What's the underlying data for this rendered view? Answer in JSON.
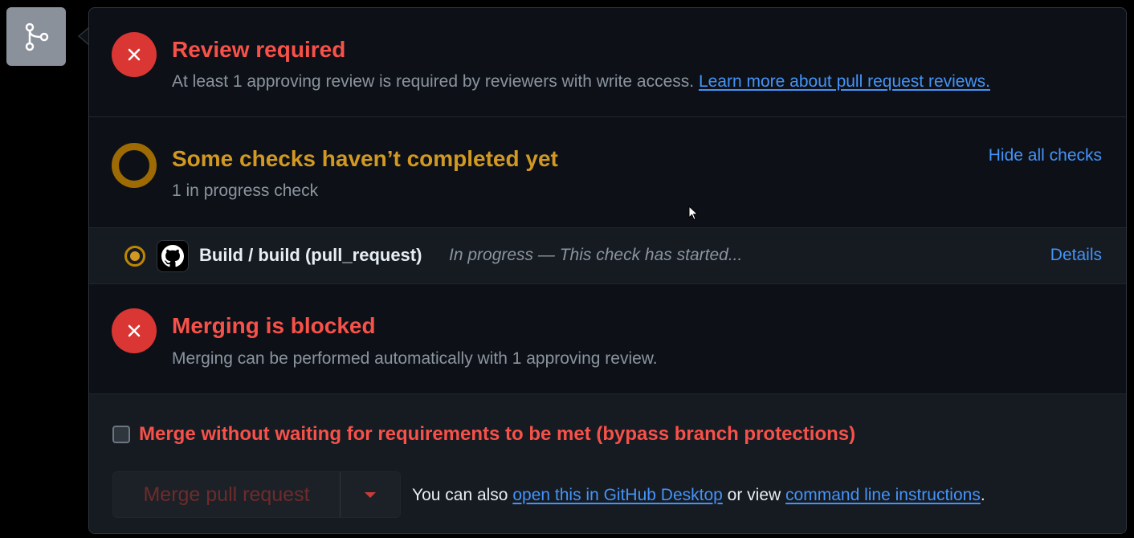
{
  "icons": {
    "merge": "git-merge-icon",
    "x": "x-icon",
    "pending": "pending-ring-icon",
    "in_progress": "in-progress-dot-icon",
    "github": "github-icon",
    "caret": "caret-down-icon",
    "cursor": "mouse-cursor-icon"
  },
  "colors": {
    "danger": "#f85149",
    "danger_bg": "#da3633",
    "attention": "#d29922",
    "link": "#4493f8",
    "muted": "#8b949e",
    "text": "#e6edf3"
  },
  "review": {
    "title": "Review required",
    "desc": "At least 1 approving review is required by reviewers with write access.",
    "link": "Learn more about pull request reviews."
  },
  "checks": {
    "title": "Some checks haven’t completed yet",
    "subtitle": "1 in progress check",
    "toggle": "Hide all checks",
    "items": [
      {
        "name": "Build / build (pull_request)",
        "status": "In progress — This check has started...",
        "details": "Details"
      }
    ]
  },
  "merging": {
    "title": "Merging is blocked",
    "desc": "Merging can be performed automatically with 1 approving review."
  },
  "merge_box": {
    "bypass_label": "Merge without waiting for requirements to be met (bypass branch protections)",
    "bypass_checked": false,
    "merge_button": "Merge pull request",
    "also_prefix": "You can also",
    "desktop_link": "open this in GitHub Desktop",
    "or_view": "or view",
    "cli_link": "command line instructions",
    "period": "."
  }
}
